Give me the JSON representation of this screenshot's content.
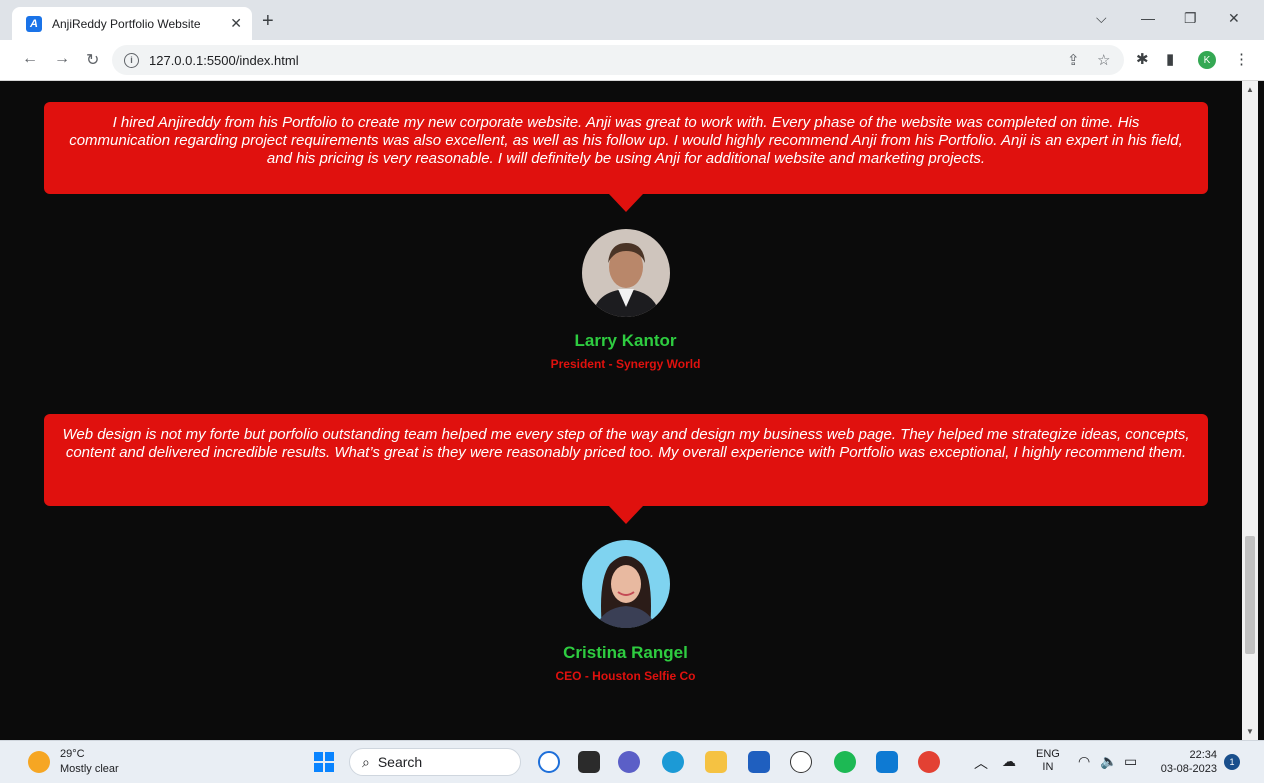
{
  "browser": {
    "tab_title": "AnjiReddy Portfolio Website",
    "tab_favicon_letter": "A",
    "url": "127.0.0.1:5500/index.html",
    "profile_initial": "K"
  },
  "testimonials": [
    {
      "quote": "I hired Anjireddy from his Portfolio to create my new corporate website. Anji was great to work with. Every phase of the website was completed on time. His communication regarding project requirements was also excellent, as well as his follow up. I would highly recommend Anji from his Portfolio. Anji is an expert in his field, and his pricing is very reasonable. I will definitely be using Anji for additional website and marketing projects.",
      "name": "Larry Kantor",
      "role": "President - Synergy World"
    },
    {
      "quote": "Web design is not my forte but porfolio outstanding team helped me every step of the way and design my business web page. They helped me strategize ideas, concepts, content and delivered incredible results. What’s great is they were reasonably priced too. My overall experience with Portfolio was exceptional, I highly recommend them.",
      "name": "Cristina Rangel",
      "role": "CEO - Houston Selfie Co"
    }
  ],
  "taskbar": {
    "temperature": "29°C",
    "weather": "Mostly clear",
    "search_label": "Search",
    "language_top": "ENG",
    "language_bottom": "IN",
    "time": "22:34",
    "date": "03-08-2023",
    "notification_count": "1"
  },
  "colors": {
    "card": "#e0110e",
    "name": "#2ecc40",
    "background": "#0b0b0b"
  }
}
